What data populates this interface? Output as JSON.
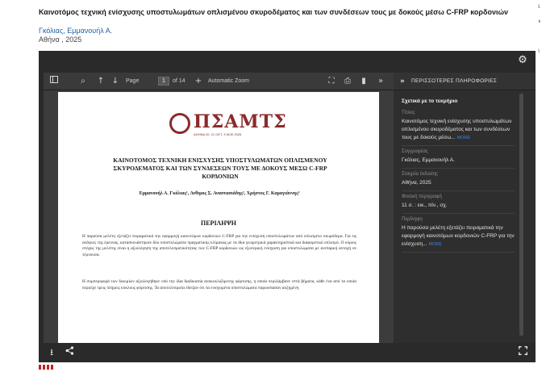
{
  "document": {
    "title": "Καινοτόμος τεχνική ενίσχυσης υποστυλωμάτων οπλισμένου σκυροδέματος και των συνδέσεων τους με δοκούς μέσω C-FRP κορδονιών",
    "author": "Γκόλιας, Εμμανουήλ Α.",
    "place_year": "Αθήνα , 2025"
  },
  "toolbar": {
    "page_label": "Page",
    "page_value": "1",
    "page_count": "of 14",
    "zoom_label": "Automatic Zoom"
  },
  "pdf_page": {
    "logo_text": "ΠΣΑΜΤΣ",
    "logo_subtext": "ΑΘΗΝΑ 20, 21 ΟΚΤ, 3 ΝΟΕ 2025",
    "title": "ΚΑΙΝΟΤΟΜΟΣ ΤΕΧΝΙΚΗ ΕΝΙΣΧΥΣΗΣ ΥΠΟΣΤΥΛΩΜΑΤΩΝ ΟΠΛΙΣΜΕΝΟΥ ΣΚΥΡΟΔΕΜΑΤΟΣ ΚΑΙ ΤΩΝ ΣΥΝΔΕΣΕΩΝ ΤΟΥΣ ΜΕ ΔΟΚΟΥΣ ΜΕΣΩ C-FRP ΚΟΡΔΟΝΙΩΝ",
    "authors": "Εμμανουήλ Α. Γκόλιας¹, Ανθιμος Σ. Αναστασιάδης², Χρήστος Γ. Καραγιάννης³",
    "abstract_heading": "ΠΕΡΙΛΗΨΗ",
    "abstract_p1": "Η παρούσα μελέτη εξετάζει πειραματικά την εφαρμογή καινοτόμων κορδονιών C-FRP για την ενίσχυση υποστυλωμάτων από οπλισμένο σκυρόδεμα. Για τις ανάγκες της έρευνας, κατασκευάστηκαν δύο υποστυλώματα πραγματικής κλίμακας με τα ίδια γεωμετρικά χαρακτηριστικά και διαφορετικό οπλισμό. Ο κύριος στόχος της μελέτης είναι η αξιολόγηση της αποτελεσματικότητας των C-FRP κορδονιών ως εξωτερική ενίσχυση για υποστυλώματα με ανεπαρκή αντοχή σε τέμνουσα.",
    "abstract_p2": "Η συμπεριφορά των δοκιμίων αξιολογήθηκε υπό την ίδια διαδικασία ανακυκλιζόμενης φόρτισης, η οποία περιλάμβανε επτά βήματα, κάθε ένα από τα οποία περιείχε τρεις πλήρεις κύκλους φόρτισης. Τα αποτελέσματα έδειξαν ότι τα ενισχυμένα υποστυλώματα παρουσίασαν αυξημένη"
  },
  "info_panel": {
    "header": "ΠΕΡΙΣΣΟΤΕΡΕΣ ΠΛΗΡΟΦΟΡΙΕΣ",
    "section_title": "Σχετικά με το τεκμήριο",
    "fields": [
      {
        "label": "Τίτλος",
        "value": "Καινοτόμος τεχνική ενίσχυσης υποστυλωμάτων οπλισμένου σκυροδέματος και των συνδέσεων τους με δοκούς μέσω...",
        "more": "MORE"
      },
      {
        "label": "Συγγραφέας",
        "value": "Γκόλιας, Εμμανουήλ Α.",
        "more": ""
      },
      {
        "label": "Στοιχεία έκδοσης",
        "value": "Αθήνα, 2025",
        "more": ""
      },
      {
        "label": "Φυσική περιγραφή",
        "value": "11 σ. : εικ., πίν., σχ.",
        "more": ""
      },
      {
        "label": "Περίληψη",
        "value": "Η παρούσα μελέτη εξετάζει πειραματικά την εφαρμογή καινοτόμων κορδονιών C-FRP για την ενίσχυση...",
        "more": "MORE"
      }
    ]
  },
  "icons": {
    "settings": "gear-icon",
    "sidebar": "sidebar-toggle-icon",
    "search": "search-icon",
    "prev": "arrow-up-icon",
    "next": "arrow-down-icon",
    "zoom_in": "plus-icon",
    "fullscreen": "expand-icon",
    "print": "print-icon",
    "bookmark": "bookmark-icon",
    "more": "double-chevron-icon",
    "download": "download-icon",
    "share": "share-icon"
  },
  "colors": {
    "viewer_bg": "#2a2a2a",
    "link_blue": "#1f62a8",
    "logo_red": "#8a2b2b"
  }
}
